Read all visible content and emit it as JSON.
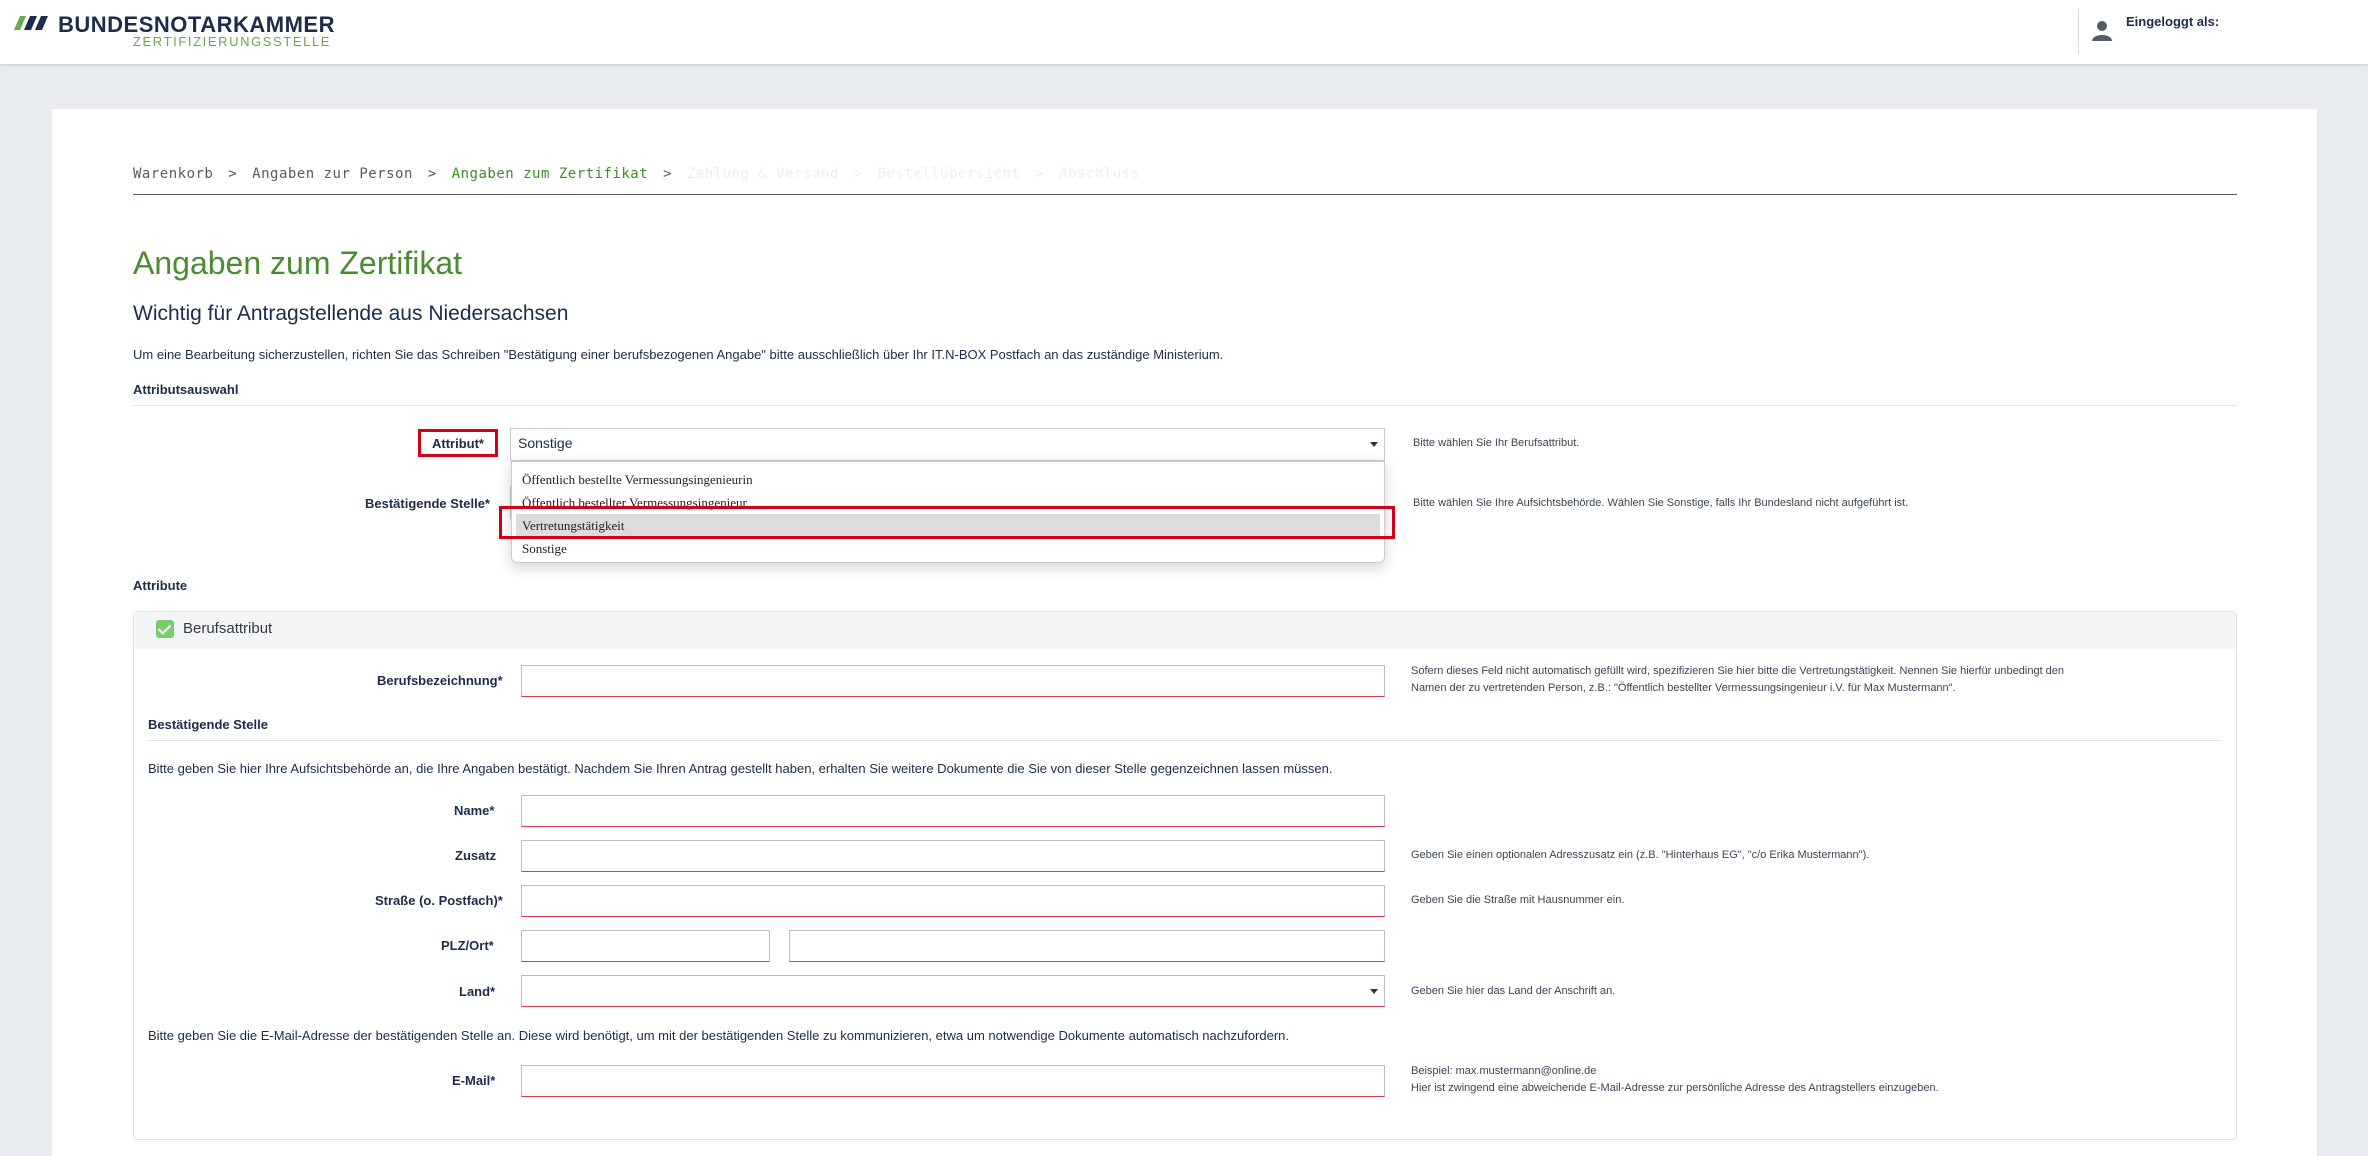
{
  "header": {
    "brand_title": "BUNDESNOTARKAMMER",
    "brand_subtitle": "ZERTIFIZIERUNGSSTELLE",
    "user_label": "Eingeloggt als:",
    "brand_colors": {
      "navy": "#1d2c4a",
      "green": "#6aa84f"
    }
  },
  "breadcrumb": {
    "steps": [
      {
        "label": "Warenkorb",
        "state": "done"
      },
      {
        "label": "Angaben zur Person",
        "state": "done"
      },
      {
        "label": "Angaben zum Zertifikat",
        "state": "active"
      },
      {
        "label": "Zahlung & Versand",
        "state": "future"
      },
      {
        "label": "Bestellübersicht",
        "state": "future"
      },
      {
        "label": "Abschluss",
        "state": "future"
      }
    ],
    "separator": ">"
  },
  "page": {
    "title": "Angaben zum Zertifikat",
    "subtitle": "Wichtig für Antragstellende aus Niedersachsen",
    "intro": "Um eine Bearbeitung sicherzustellen, richten Sie das Schreiben \"Bestätigung einer berufsbezogenen Angabe\" bitte ausschließlich über Ihr IT.N-BOX Postfach an das zuständige Ministerium."
  },
  "attributsauswahl": {
    "heading": "Attributsauswahl",
    "attribut": {
      "label": "Attribut*",
      "selected": "Sonstige",
      "hint": "Bitte wählen Sie Ihr Berufsattribut.",
      "options": [
        "Öffentlich bestellte Vermessungsingenieurin",
        "Öffentlich bestellter Vermessungsingenieur",
        "Vertretungstätigkeit",
        "Sonstige"
      ],
      "highlighted_option": "Vertretungstätigkeit"
    },
    "bestaetigende_stelle": {
      "label": "Bestätigende Stelle*",
      "hint": "Bitte wählen Sie Ihre Aufsichtsbehörde. Wählen Sie Sonstige, falls Ihr Bundesland nicht aufgeführt ist."
    }
  },
  "attribute": {
    "heading": "Attribute",
    "panel_title": "Berufsattribut",
    "berufsbezeichnung": {
      "label": "Berufsbezeichnung*",
      "value": "",
      "hint_line1": "Sofern dieses Feld nicht automatisch gefüllt wird, spezifizieren Sie hier bitte die Vertretungstätigkeit. Nennen Sie hierfür unbedingt den",
      "hint_line2": "Namen der zu vertretenden Person, z.B.: \"Öffentlich bestellter Vermessungsingenieur i.V. für Max Mustermann\"."
    }
  },
  "stelle": {
    "heading": "Bestätigende Stelle",
    "intro": "Bitte geben Sie hier Ihre Aufsichtsbehörde an, die Ihre Angaben bestätigt. Nachdem Sie Ihren Antrag gestellt haben, erhalten Sie weitere Dokumente die Sie von dieser Stelle gegenzeichnen lassen müssen.",
    "name": {
      "label": "Name*",
      "value": ""
    },
    "zusatz": {
      "label": "Zusatz",
      "value": "",
      "hint": "Geben Sie einen optionalen Adresszusatz ein (z.B. \"Hinterhaus EG\", \"c/o Erika Mustermann\")."
    },
    "strasse": {
      "label": "Straße (o. Postfach)*",
      "value": "",
      "hint": "Geben Sie die Straße mit Hausnummer ein."
    },
    "plz_ort": {
      "label": "PLZ/Ort*",
      "plz": "",
      "ort": ""
    },
    "land": {
      "label": "Land*",
      "value": "",
      "hint": "Geben Sie hier das Land der Anschrift an."
    },
    "email_intro": "Bitte geben Sie die E-Mail-Adresse der bestätigenden Stelle an. Diese wird benötigt, um mit der bestätigenden Stelle zu kommunizieren, etwa um notwendige Dokumente automatisch nachzufordern.",
    "email": {
      "label": "E-Mail*",
      "value": "",
      "hint_line1": "Beispiel: max.mustermann@online.de",
      "hint_line2": "Hier ist zwingend eine abweichende E-Mail-Adresse zur persönliche Adresse des Antragstellers einzugeben."
    }
  }
}
